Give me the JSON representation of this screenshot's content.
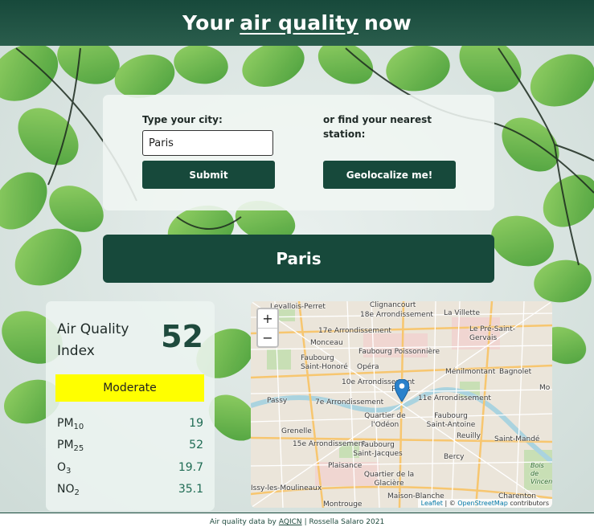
{
  "header": {
    "prefix": "Your",
    "highlight": "air quality",
    "suffix": "now"
  },
  "search": {
    "city_label": "Type your city:",
    "city_value": "Paris",
    "submit_label": "Submit",
    "geo_label": "or find your nearest station:",
    "geo_button": "Geolocalize me!"
  },
  "city_banner": "Paris",
  "aqi": {
    "title": "Air Quality Index",
    "value": "52",
    "level": "Moderate",
    "level_color": "#ffff00",
    "pollutants": [
      {
        "name": "PM",
        "sub": "10",
        "value": "19"
      },
      {
        "name": "PM",
        "sub": "25",
        "value": "52"
      },
      {
        "name": "O",
        "sub": "3",
        "value": "19.7"
      },
      {
        "name": "NO",
        "sub": "2",
        "value": "35.1"
      }
    ]
  },
  "map": {
    "zoom_in": "+",
    "zoom_out": "−",
    "labels": [
      "Levallois-Perret",
      "Clignancourt",
      "La Villette",
      "18e Arrondissement",
      "17e Arrondissement",
      "Le Pré-Saint-Gervais",
      "Monceau",
      "Faubourg Poissonnière",
      "Faubourg Saint-Honoré",
      "Opéra",
      "Ménilmontant",
      "Bagnolet",
      "10e Arrondissement",
      "Paris",
      "11e Arrondissement",
      "7e Arrondissement",
      "Passy",
      "Quartier de l'Odéon",
      "Faubourg Saint-Antoine",
      "Grenelle",
      "Reuilly",
      "Saint-Mandé",
      "15e Arrondissement",
      "Faubourg Saint-Jacques",
      "Plaisance",
      "Bercy",
      "Quartier de la Glacière",
      "Issy-les-Moulineaux",
      "Maison-Blanche",
      "Charenton",
      "Montrouge",
      "Bois de Vincennes",
      "Mo"
    ],
    "attribution_leaflet": "Leaflet",
    "attribution_sep": " | © ",
    "attribution_osm": "OpenStreetMap",
    "attribution_tail": " contributors"
  },
  "footer": {
    "prefix": "Air quality data by",
    "link": "AQICN",
    "suffix": "| Rossella Salaro 2021"
  },
  "colors": {
    "primary": "#17493b",
    "accent_value": "#1e6b53",
    "moderate": "#ffff00"
  }
}
